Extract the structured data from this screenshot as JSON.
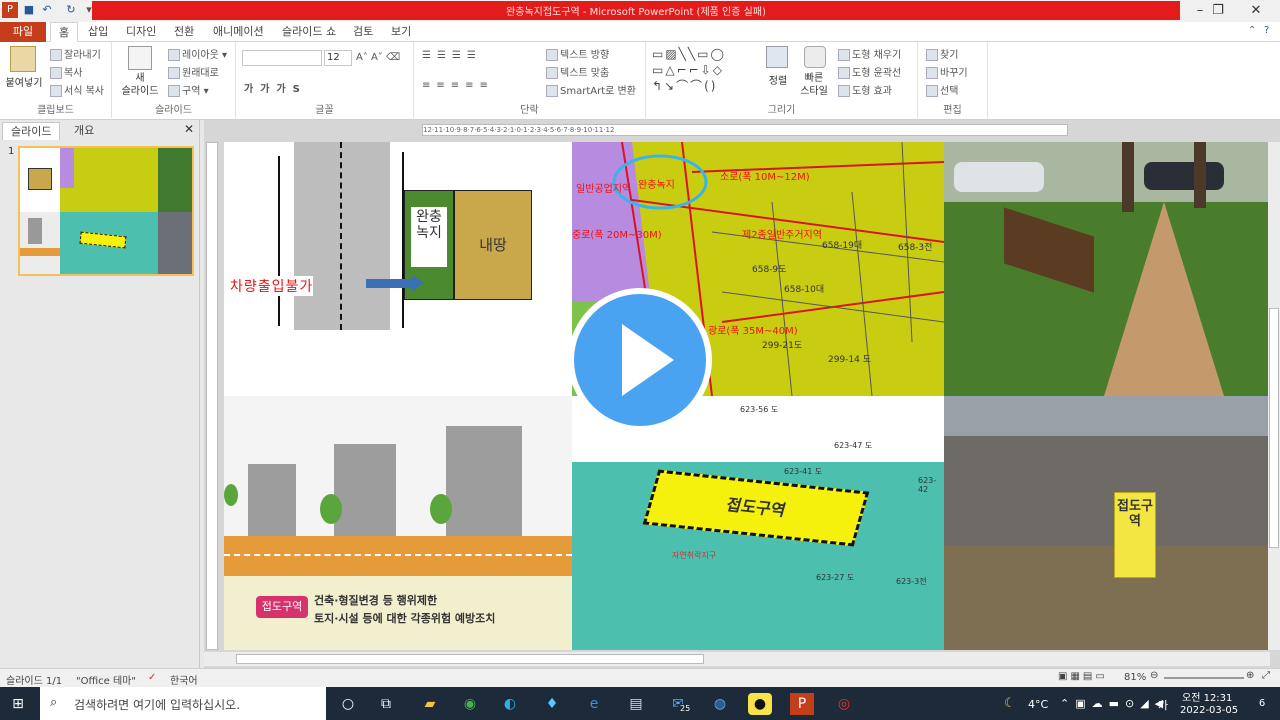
{
  "window": {
    "title": "완충녹지접도구역 - Microsoft PowerPoint (제품 인증 실패)",
    "quick_access": [
      "save-icon",
      "undo-icon",
      "redo-icon"
    ],
    "controls": [
      "minimize",
      "restore",
      "close"
    ]
  },
  "ribbon_tabs": [
    "파일",
    "홈",
    "삽입",
    "디자인",
    "전환",
    "애니메이션",
    "슬라이드 쇼",
    "검토",
    "보기"
  ],
  "ribbon": {
    "clipboard": {
      "paste": "붙여넣기",
      "cut": "잘라내기",
      "copy": "복사",
      "format_painter": "서식 복사",
      "label": "클립보드"
    },
    "slides": {
      "new": "새\n슬라이드",
      "layout": "레이아웃",
      "reset": "원래대로",
      "section": "구역",
      "label": "슬라이드"
    },
    "font": {
      "size": "12",
      "label": "글꼴"
    },
    "paragraph": {
      "text_direction": "텍스트 방향",
      "align_text": "텍스트 맞춤",
      "smartart": "SmartArt로 변환",
      "label": "단락"
    },
    "drawing": {
      "arrange": "정렬",
      "quick_styles": "빠른\n스타일",
      "fill": "도형 채우기",
      "outline": "도형 윤곽선",
      "effects": "도형 효과",
      "label": "그리기"
    },
    "editing": {
      "find": "찾기",
      "replace": "바꾸기",
      "select": "선택",
      "label": "편집"
    }
  },
  "panel": {
    "tab_slides": "슬라이드",
    "tab_outline": "개요",
    "slide_number": "1"
  },
  "slide": {
    "q1": {
      "buffer_label": "완충녹지",
      "my_land": "내땅",
      "no_entry": "차량출입불가"
    },
    "q2": {
      "labels": [
        "일반공업지역",
        "완충녹지",
        "소로(폭 10M~12M)",
        "제2종일반주거지역",
        "658-10대",
        "658-3전",
        "658-19대",
        "658-9도",
        "299-21도",
        "299-14 도",
        "광로(폭 35M~40M)",
        "중로(폭 20M~30M)"
      ]
    },
    "q4": {
      "zone_label": "접도구역",
      "desc_line1": "건축·형질변경 등 행위제한",
      "desc_line2": "토지·시설 등에 대한 각종위험 예방조치"
    },
    "q5": {
      "zone_label": "접도구역",
      "parcels": [
        "623-56 도",
        "623-47 도",
        "623-41 도",
        "623-27 도",
        "623-3전",
        "623-42"
      ],
      "sub_label": "자연취락지구"
    },
    "q6": {
      "sign_label": "접도구역"
    }
  },
  "ruler": "12·11·10·9·8·7·6·5·4·3·2·1·0·1·2·3·4·5·6·7·8·9·10·11·12",
  "status": {
    "slide": "슬라이드 1/1",
    "theme": "\"Office 테마\"",
    "lang": "한국어",
    "zoom": "81%"
  },
  "taskbar": {
    "search": "검색하려면 여기에 입력하십시오.",
    "temp": "4°C",
    "ime": "가",
    "time": "오전 12:31",
    "date": "2022-03-05",
    "badge": "25",
    "notif": "6"
  },
  "colors": {
    "accent": "#c43e1c",
    "title_red": "#e31b1b",
    "play": "#4aa3f0"
  }
}
